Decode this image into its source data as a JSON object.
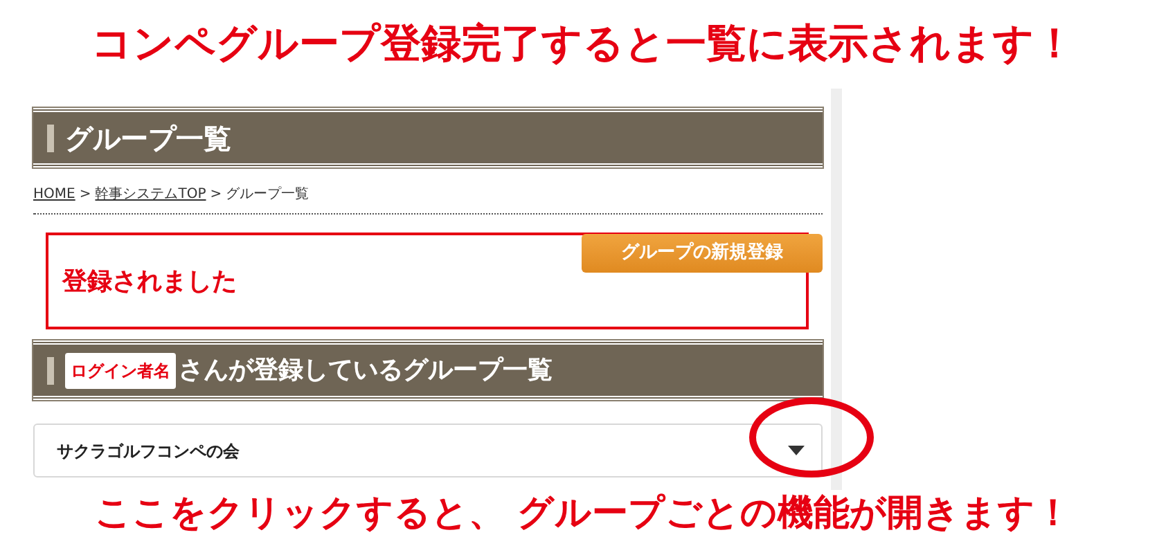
{
  "annotation_title": "コンペグループ登録完了すると一覧に表示されます！",
  "page_title": "グループ一覧",
  "breadcrumb": [
    {
      "label": "HOME",
      "kind": "link"
    },
    {
      "label": ">",
      "kind": "separator"
    },
    {
      "label": "幹事システムTOP",
      "kind": "link"
    },
    {
      "label": ">",
      "kind": "separator"
    },
    {
      "label": "グループ一覧",
      "kind": "current"
    }
  ],
  "message": "登録されました",
  "new_group_button": "グループの新規登録",
  "section_heading": {
    "badge": "ログイン者名",
    "text": "さんが登録しているグループ一覧"
  },
  "group_select": {
    "value": "サクラゴルフコンペの会"
  },
  "annotation_note": "ここをクリックすると、 グループごとの機能が開きます！"
}
